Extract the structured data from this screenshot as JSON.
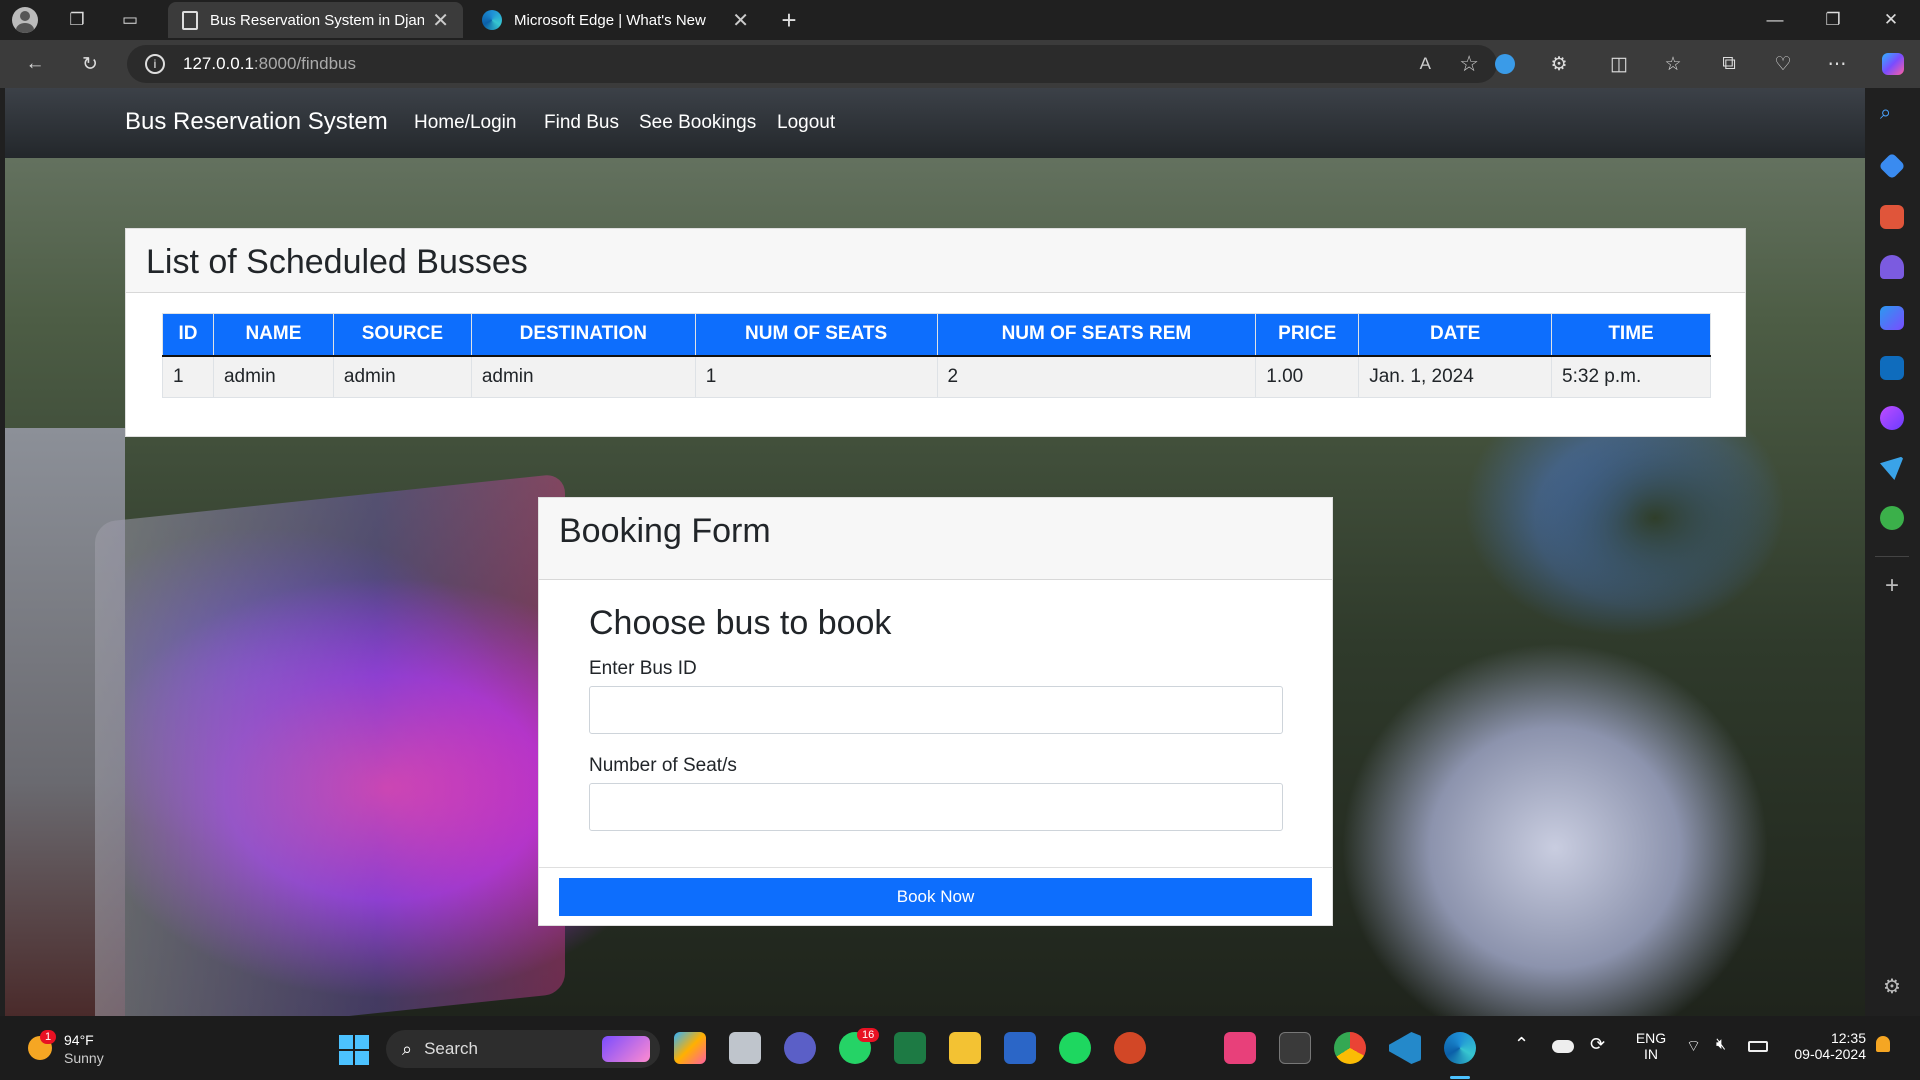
{
  "browser": {
    "tabs": [
      {
        "title": "Bus Reservation System in Djang"
      },
      {
        "title": "Microsoft Edge | What's New"
      }
    ],
    "url_host": "127.0.0.1",
    "url_path": ":8000/findbus"
  },
  "navbar": {
    "brand": "Bus Reservation System",
    "links": [
      "Home/Login",
      "Find Bus",
      "See Bookings",
      "Logout"
    ]
  },
  "bus_list": {
    "title": "List of Scheduled Busses",
    "columns": [
      "ID",
      "NAME",
      "SOURCE",
      "DESTINATION",
      "NUM OF SEATS",
      "NUM OF SEATS REM",
      "PRICE",
      "DATE",
      "TIME"
    ],
    "rows": [
      [
        "1",
        "admin",
        "admin",
        "admin",
        "1",
        "2",
        "1.00",
        "Jan. 1, 2024",
        "5:32 p.m."
      ]
    ]
  },
  "booking": {
    "title": "Booking Form",
    "subtitle": "Choose bus to book",
    "bus_id_label": "Enter Bus ID",
    "bus_id_value": "",
    "seats_label": "Number of Seat/s",
    "seats_value": "",
    "submit_label": "Book Now"
  },
  "taskbar": {
    "weather_temp": "94°F",
    "weather_desc": "Sunny",
    "weather_badge": "1",
    "search_label": "Search",
    "whatsapp_badge": "16",
    "lang_top": "ENG",
    "lang_bottom": "IN",
    "time": "12:35",
    "date": "09-04-2024"
  },
  "colors": {
    "primary": "#0d6efd",
    "navbar": "#23272b"
  }
}
